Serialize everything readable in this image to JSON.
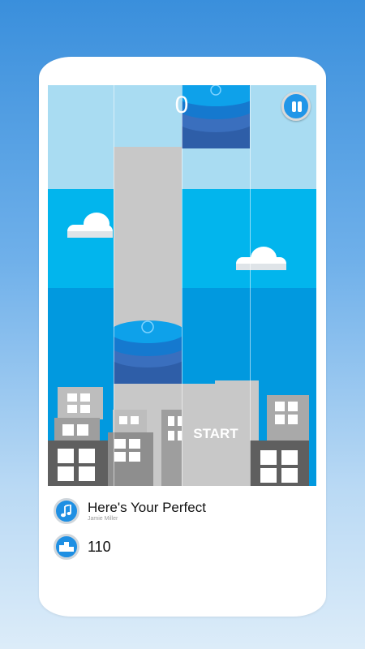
{
  "game": {
    "score": "0",
    "start_label": "START"
  },
  "song": {
    "title": "Here's Your Perfect",
    "artist": "Jamie Miller"
  },
  "best_score": "110",
  "icons": {
    "pause": "pause-icon",
    "song": "music-note-icon",
    "best": "podium-icon"
  },
  "colors": {
    "tile_top": "#0ea1ea",
    "tile_bottom": "#2e67b7",
    "button": "#1e8fe3",
    "sky_light": "#a9dcf2",
    "sky_mid": "#02b5ed",
    "sky_deep": "#0199df"
  }
}
